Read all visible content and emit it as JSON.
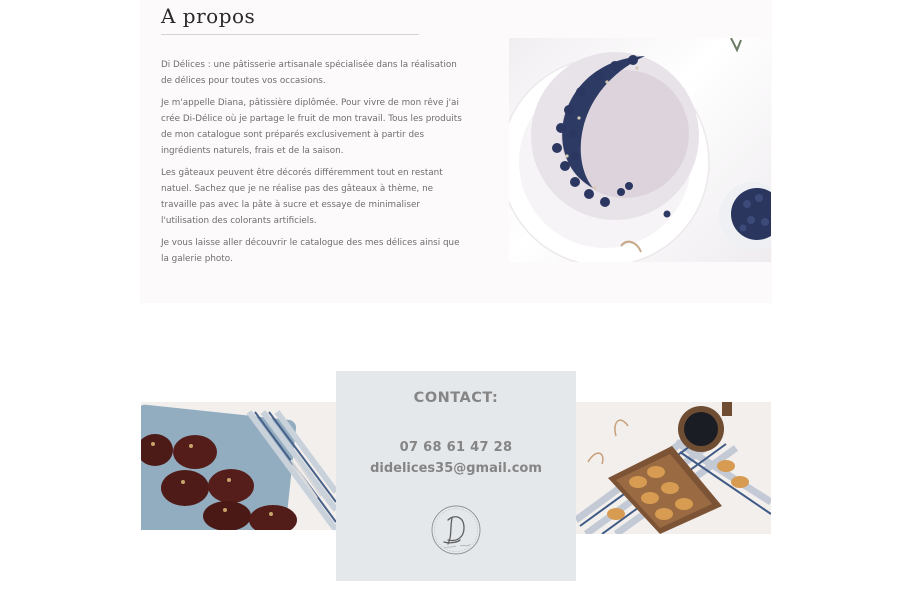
{
  "about": {
    "title": "A propos",
    "paragraphs": [
      "Di Délices : une pâtisserie artisanale spécialisée dans la réalisation de délices pour toutes vos occasions.",
      "Je m'appelle Diana, pâtissière diplômée. Pour vivre de mon rêve j'ai crée Di-Délice où je partage le fruit de mon travail. Tous les produits de mon catalogue sont préparés exclusivement à partir des ingrédients naturels, frais et de la saison.",
      "Les gâteaux peuvent être décorés différemment tout en restant natuel. Sachez que je ne réalise pas des gâteaux à thème, ne travaille pas avec la pâte à sucre et essaye de minimaliser l'utilisation des colorants artificiels.",
      "Je vous laisse aller découvrir le catalogue des mes délices ainsi que la galerie photo."
    ]
  },
  "contact": {
    "title": "CONTACT:",
    "phone": "07 68 61 47 28",
    "email": "didelices35@gmail.com",
    "logo_icon": "di-delices-logo-icon"
  },
  "colors": {
    "about_bg": "#fdfafb",
    "contact_bg": "#e4e8eb",
    "contact_text": "#858585",
    "body_text": "#6d6d6d"
  }
}
